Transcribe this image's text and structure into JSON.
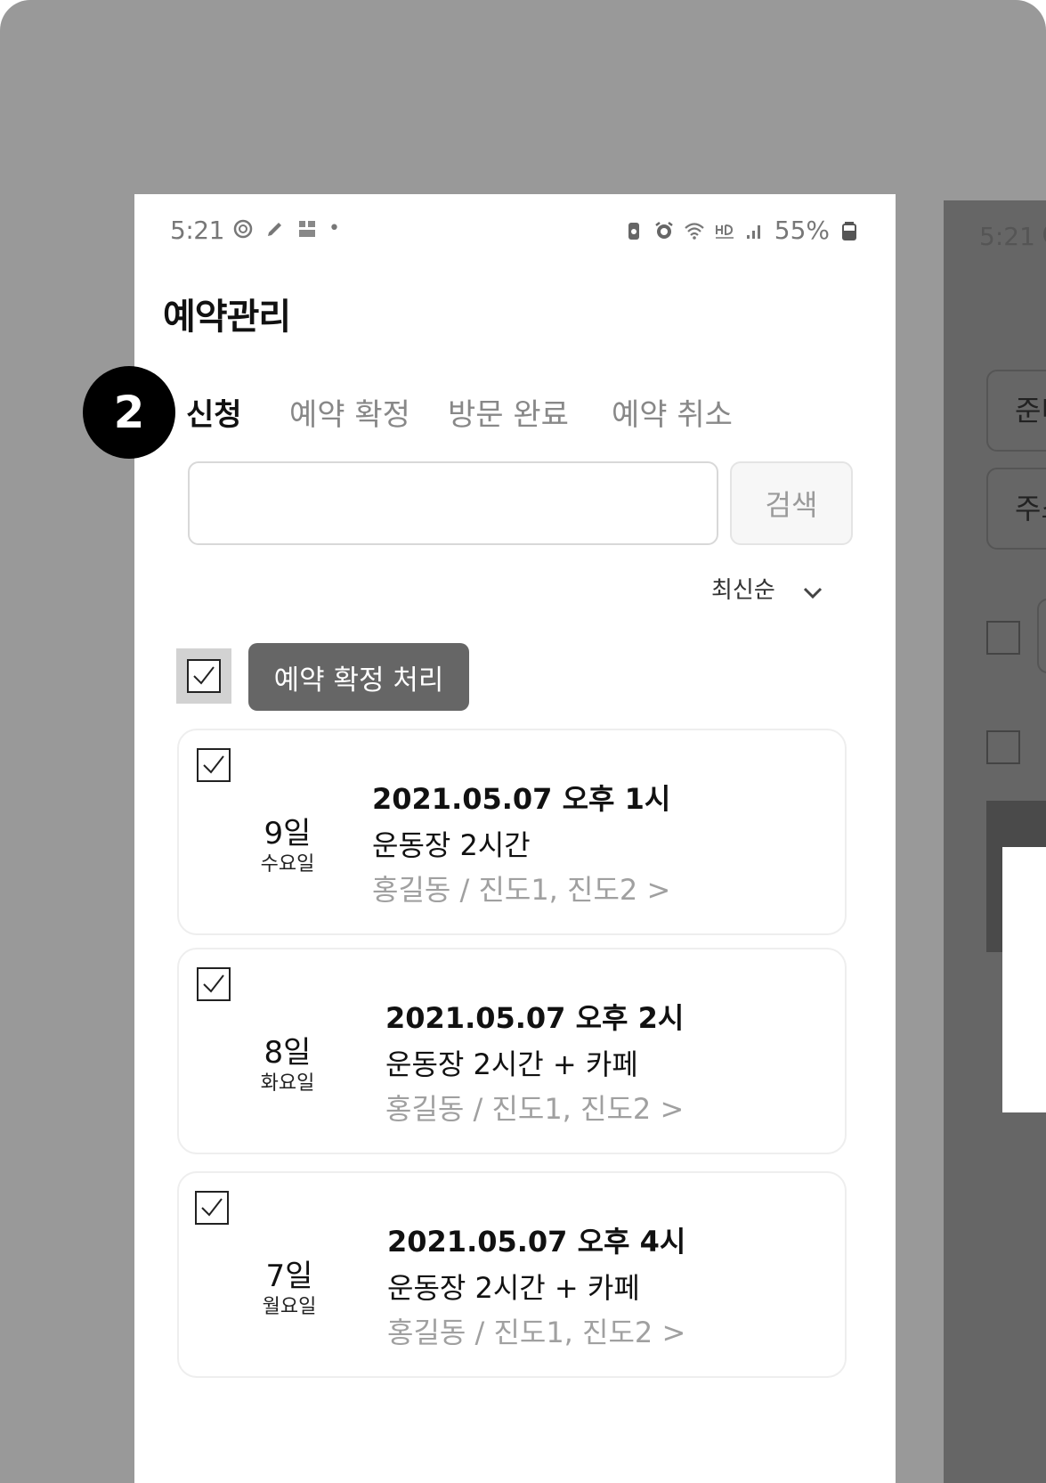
{
  "status_bar": {
    "time": "5:21",
    "battery": "55%",
    "left_icons": [
      "settings-icon",
      "pen-icon",
      "app-icon"
    ],
    "right_icons": [
      "battery-saver-icon",
      "alarm-icon",
      "wifi-icon",
      "hd-voice-icon",
      "signal-icon",
      "battery-icon"
    ]
  },
  "header": {
    "title": "예약관리"
  },
  "tabs": [
    {
      "label": "신청",
      "active": true
    },
    {
      "label": "예약 확정",
      "active": false
    },
    {
      "label": "방문 완료",
      "active": false
    },
    {
      "label": "예약 취소",
      "active": false
    }
  ],
  "search": {
    "value": "",
    "placeholder": "",
    "button_label": "검색"
  },
  "sort": {
    "selected": "최신순"
  },
  "bulk_action": {
    "button_label": "예약 확정 처리",
    "all_checked": true
  },
  "reservations": [
    {
      "day": "9일",
      "weekday": "수요일",
      "datetime": "2021.05.07 오후 1시",
      "service": "운동장 2시간",
      "customer": "홍길동 / 진도1, 진도2  >",
      "checked": true
    },
    {
      "day": "8일",
      "weekday": "화요일",
      "datetime": "2021.05.07 오후 2시",
      "service": "운동장 2시간 + 카페",
      "customer": "홍길동 / 진도1, 진도2  >",
      "checked": true
    },
    {
      "day": "7일",
      "weekday": "월요일",
      "datetime": "2021.05.07 오후 4시",
      "service": "운동장 2시간 + 카페",
      "customer": "홍길동 / 진도1, 진도2  >",
      "checked": true
    }
  ],
  "step_badge": "2",
  "second_screen": {
    "time": "5:21",
    "button_1": "준비",
    "button_2": "주소"
  },
  "colors": {
    "backdrop": "#999999",
    "primary_button": "#666666",
    "muted_text": "#a0a0a0",
    "badge": "#000000"
  }
}
